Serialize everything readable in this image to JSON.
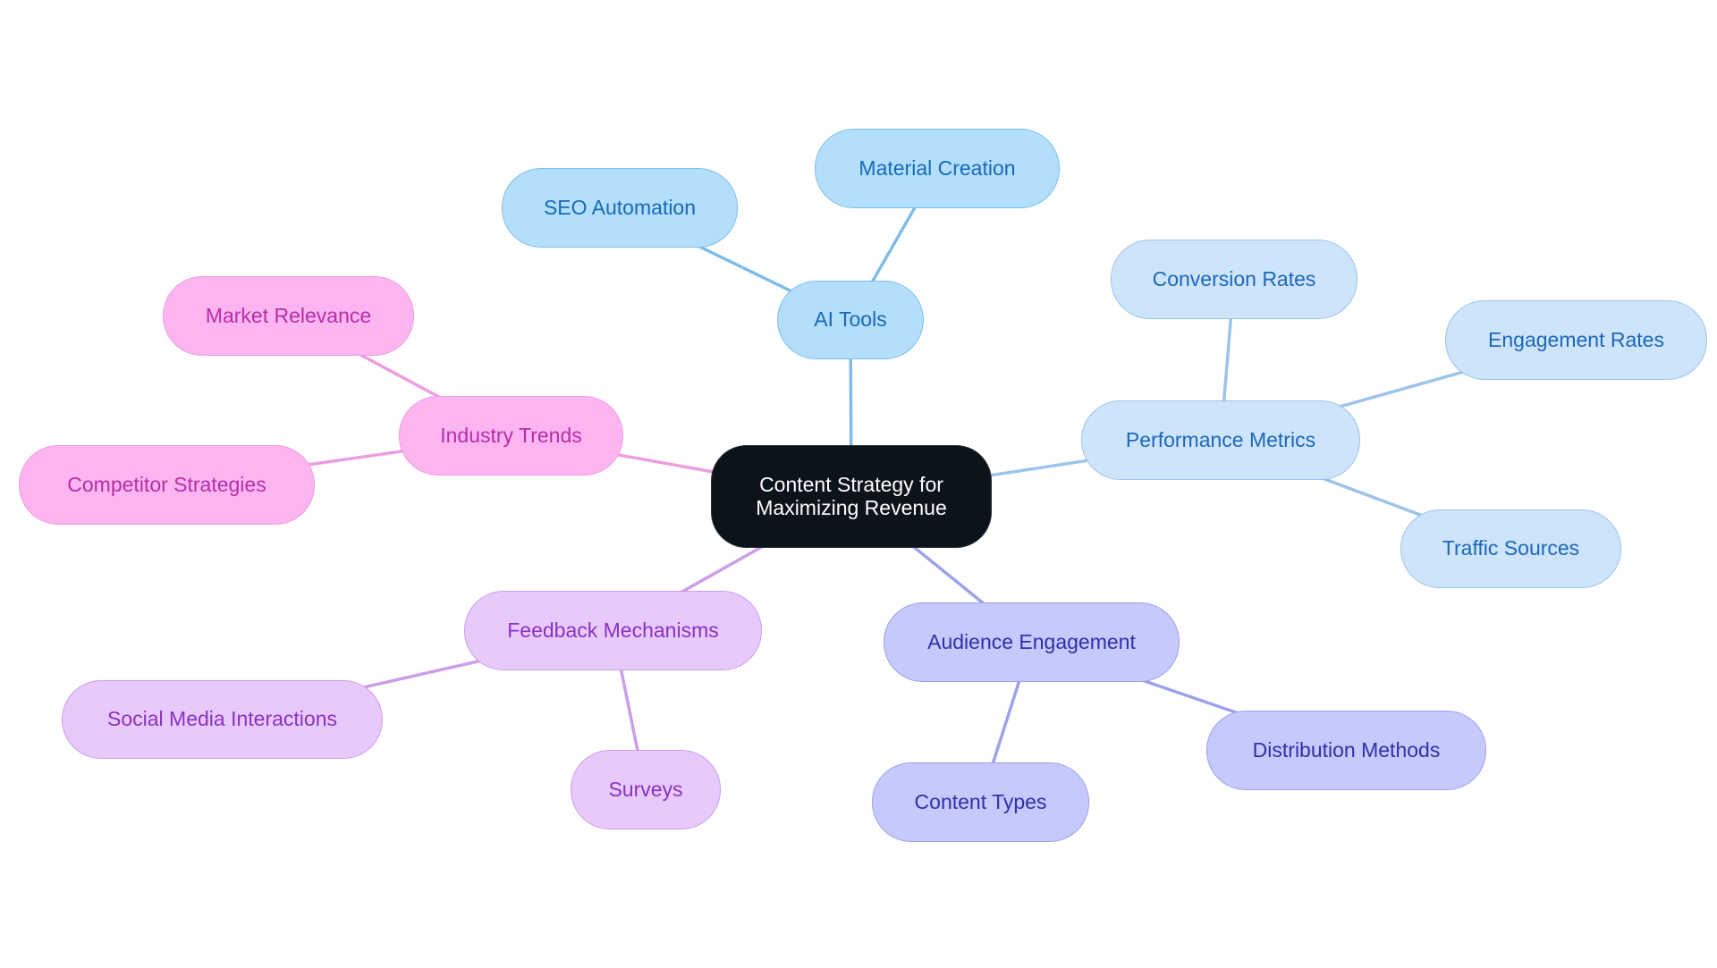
{
  "diagram": {
    "title": "Content Strategy for Maximizing Revenue",
    "root": {
      "id": "root",
      "label": "Content Strategy for Maximizing Revenue",
      "lines": [
        "Content Strategy for",
        "Maximizing Revenue"
      ],
      "colors": {
        "fill": "#0c131a",
        "stroke": "#2a2f35",
        "text": "#ffffff"
      }
    },
    "branches": [
      {
        "id": "ai-tools",
        "label": "AI Tools",
        "colors": {
          "fill": "#b3dffd",
          "stroke": "#7fbde8",
          "text": "#1769b8",
          "edge": "#7fbde8"
        },
        "children": [
          {
            "id": "seo-automation",
            "label": "SEO Automation"
          },
          {
            "id": "material-creation",
            "label": "Material Creation"
          }
        ]
      },
      {
        "id": "performance-metrics",
        "label": "Performance Metrics",
        "colors": {
          "fill": "#cde4fb",
          "stroke": "#9cc3ea",
          "text": "#1c68b8",
          "edge": "#9cc3ea"
        },
        "children": [
          {
            "id": "conversion-rates",
            "label": "Conversion Rates"
          },
          {
            "id": "engagement-rates",
            "label": "Engagement Rates"
          },
          {
            "id": "traffic-sources",
            "label": "Traffic Sources"
          }
        ]
      },
      {
        "id": "audience-engagement",
        "label": "Audience Engagement",
        "colors": {
          "fill": "#c6c9fc",
          "stroke": "#9da2e8",
          "text": "#2e31a8",
          "edge": "#9da2e8"
        },
        "children": [
          {
            "id": "content-types",
            "label": "Content Types"
          },
          {
            "id": "distribution-methods",
            "label": "Distribution Methods"
          }
        ]
      },
      {
        "id": "feedback-mechanisms",
        "label": "Feedback Mechanisms",
        "colors": {
          "fill": "#e8c9fc",
          "stroke": "#cc9ee8",
          "text": "#8a32c0",
          "edge": "#cc9ee8"
        },
        "children": [
          {
            "id": "social-media-interactions",
            "label": "Social Media Interactions"
          },
          {
            "id": "surveys",
            "label": "Surveys"
          }
        ]
      },
      {
        "id": "industry-trends",
        "label": "Industry Trends",
        "colors": {
          "fill": "#fdb5f1",
          "stroke": "#eb9ee0",
          "text": "#b52ea8",
          "edge": "#eb9ee0"
        },
        "children": [
          {
            "id": "market-relevance",
            "label": "Market Relevance"
          },
          {
            "id": "competitor-strategies",
            "label": "Competitor Strategies"
          }
        ]
      }
    ]
  }
}
